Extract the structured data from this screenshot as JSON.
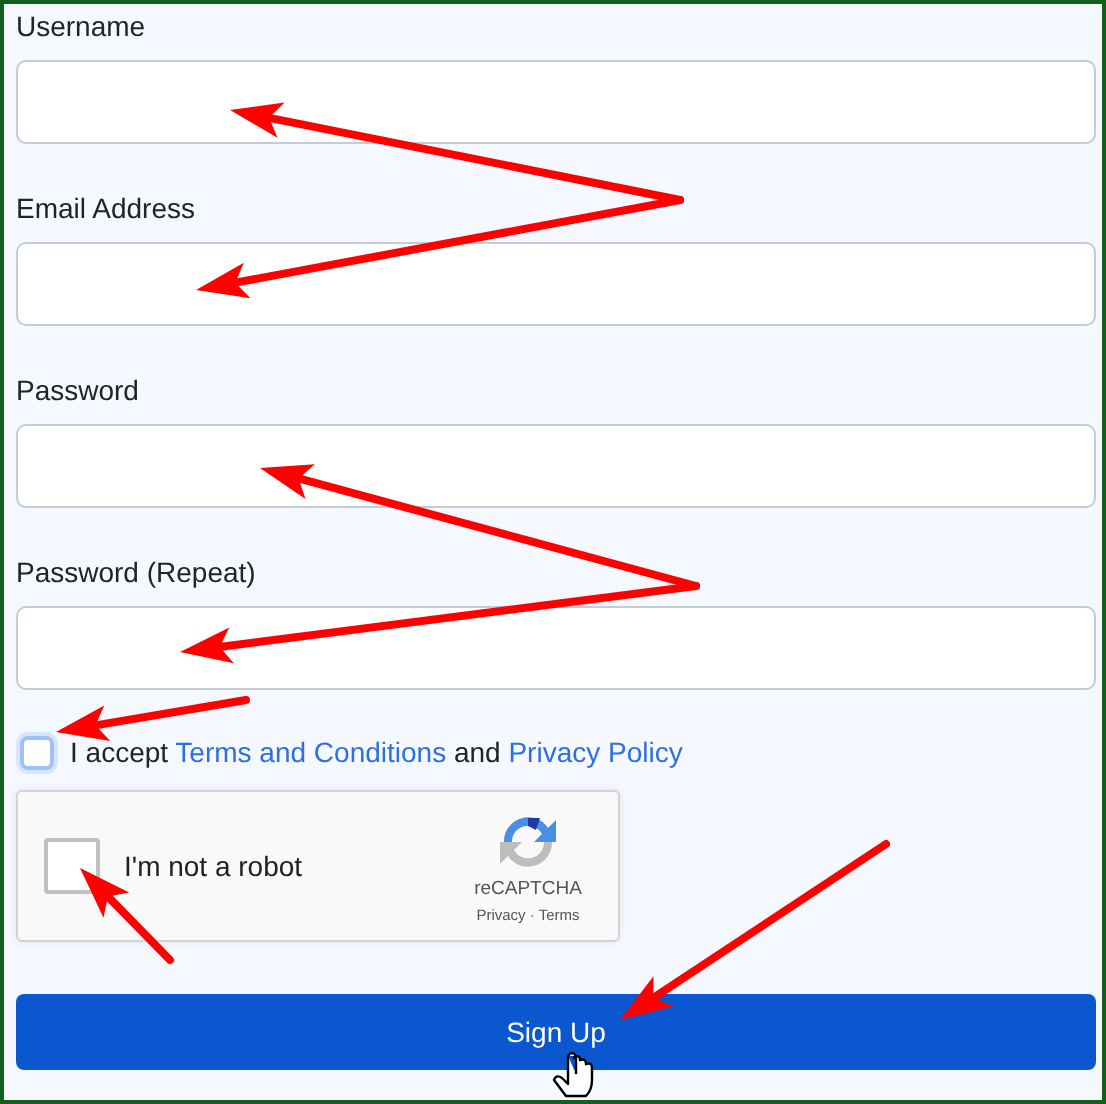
{
  "fields": [
    {
      "label": "Username"
    },
    {
      "label": "Email Address"
    },
    {
      "label": "Password"
    },
    {
      "label": "Password (Repeat)"
    }
  ],
  "terms": {
    "checked": false,
    "before": "I accept",
    "link_1": "Terms and Conditions",
    "middle": "and",
    "link_2": "Privacy Policy"
  },
  "captcha": {
    "label": "I'm not a robot",
    "checked": false,
    "brand": "reCAPTCHA",
    "footer": "Privacy · Terms"
  },
  "submit": {
    "label": "Sign Up"
  }
}
